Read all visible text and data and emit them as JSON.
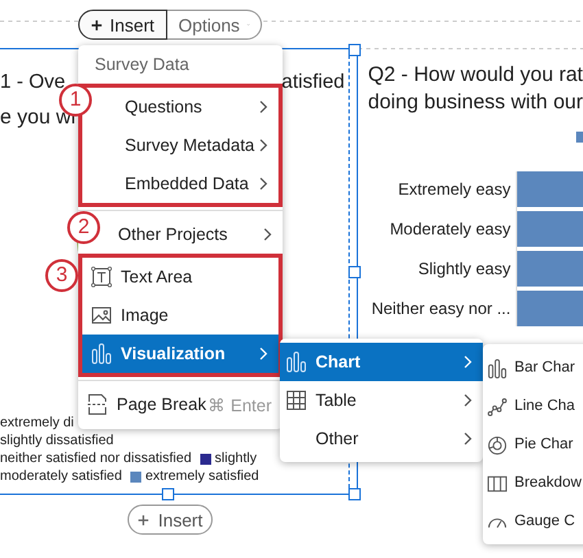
{
  "toolbar": {
    "insert": "Insert",
    "options": "Options"
  },
  "left_panel": {
    "title_start": "1 - Ove",
    "title_end": "atisfied",
    "subtitle": "e you wi",
    "legend_rows": [
      [
        {
          "label": "extremely di"
        }
      ],
      [
        {
          "label": "slightly dissatisfied"
        }
      ],
      [
        {
          "label": "neither satisfied nor dissatisfied"
        },
        {
          "label": "slightly",
          "color": "#2b2a8f"
        }
      ],
      [
        {
          "label": "moderately satisfied"
        },
        {
          "label": "extremely satisfied",
          "color": "#5b87bd"
        }
      ]
    ]
  },
  "right_panel": {
    "title_lines": [
      "Q2 - How would you rat",
      "doing business with our"
    ],
    "bar_labels": [
      "Extremely easy",
      "Moderately easy",
      "Slightly easy",
      "Neither easy nor ..."
    ]
  },
  "insert_menu": {
    "header": "Survey Data",
    "highlighted_groups": [
      true,
      false,
      true,
      false
    ],
    "groups": [
      [
        {
          "label": "Questions",
          "kind": "plain",
          "submenu": true,
          "selected": false
        },
        {
          "label": "Survey Metadata",
          "kind": "plain",
          "submenu": true,
          "selected": false
        },
        {
          "label": "Embedded Data",
          "kind": "plain",
          "submenu": true,
          "selected": false
        }
      ],
      [
        {
          "label": "Other Projects",
          "kind": "plain",
          "submenu": true,
          "selected": false
        }
      ],
      [
        {
          "label": "Text Area",
          "kind": "text-area",
          "submenu": false,
          "selected": false
        },
        {
          "label": "Image",
          "kind": "image",
          "submenu": false,
          "selected": false
        },
        {
          "label": "Visualization",
          "kind": "chart",
          "submenu": true,
          "selected": true
        }
      ],
      [
        {
          "label": "Page Break",
          "kind": "page-break",
          "submenu": false,
          "selected": false,
          "shortcut": "⌘ Enter"
        }
      ]
    ]
  },
  "visualization_menu": {
    "items": [
      {
        "label": "Chart",
        "kind": "chart",
        "selected": true
      },
      {
        "label": "Table",
        "kind": "table",
        "selected": false
      },
      {
        "label": "Other",
        "kind": "plain",
        "selected": false
      }
    ]
  },
  "chart_menu": {
    "items": [
      {
        "label": "Bar Char",
        "kind": "bar"
      },
      {
        "label": "Line Cha",
        "kind": "line"
      },
      {
        "label": "Pie Char",
        "kind": "pie"
      },
      {
        "label": "Breakdow",
        "kind": "breakdown"
      },
      {
        "label": "Gauge C",
        "kind": "gauge"
      }
    ]
  },
  "annotations": [
    {
      "number": "1"
    },
    {
      "number": "2"
    },
    {
      "number": "3"
    }
  ],
  "bottom_insert": "Insert"
}
